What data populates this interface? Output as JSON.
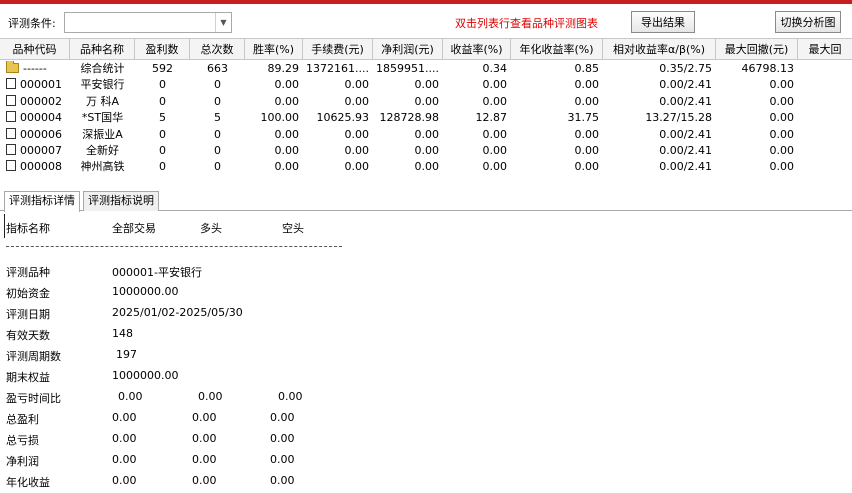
{
  "toolbar": {
    "filter_label": "评测条件:",
    "filter_value": "",
    "hint": "双击列表行查看品种评测图表",
    "export_label": "导出结果",
    "switch_label": "切换分析图"
  },
  "grid": {
    "columns": [
      "品种代码",
      "品种名称",
      "盈利数",
      "总次数",
      "胜率(%)",
      "手续费(元)",
      "净利润(元)",
      "收益率(%)",
      "年化收益率(%)",
      "相对收益率α/β(%)",
      "最大回撤(元)",
      "最大回"
    ],
    "rows": [
      {
        "icon": "folder-icon",
        "cells": [
          "------",
          "综合统计",
          "592",
          "663",
          "89.29",
          "1372161....",
          "1859951....",
          "0.34",
          "0.85",
          "0.35/2.75",
          "46798.13",
          ""
        ]
      },
      {
        "icon": "document-icon",
        "cells": [
          "000001",
          "平安银行",
          "0",
          "0",
          "0.00",
          "0.00",
          "0.00",
          "0.00",
          "0.00",
          "0.00/2.41",
          "0.00",
          ""
        ]
      },
      {
        "icon": "document-icon",
        "cells": [
          "000002",
          "万 科A",
          "0",
          "0",
          "0.00",
          "0.00",
          "0.00",
          "0.00",
          "0.00",
          "0.00/2.41",
          "0.00",
          ""
        ]
      },
      {
        "icon": "document-icon",
        "cells": [
          "000004",
          "*ST国华",
          "5",
          "5",
          "100.00",
          "10625.93",
          "128728.98",
          "12.87",
          "31.75",
          "13.27/15.28",
          "0.00",
          ""
        ]
      },
      {
        "icon": "document-icon",
        "cells": [
          "000006",
          "深振业A",
          "0",
          "0",
          "0.00",
          "0.00",
          "0.00",
          "0.00",
          "0.00",
          "0.00/2.41",
          "0.00",
          ""
        ]
      },
      {
        "icon": "document-icon",
        "cells": [
          "000007",
          "全新好",
          "0",
          "0",
          "0.00",
          "0.00",
          "0.00",
          "0.00",
          "0.00",
          "0.00/2.41",
          "0.00",
          ""
        ]
      },
      {
        "icon": "document-icon",
        "cells": [
          "000008",
          "神州高铁",
          "0",
          "0",
          "0.00",
          "0.00",
          "0.00",
          "0.00",
          "0.00",
          "0.00/2.41",
          "0.00",
          ""
        ]
      }
    ]
  },
  "tabs": [
    {
      "label": "评测指标详情",
      "active": true
    },
    {
      "label": "评测指标说明",
      "active": false
    }
  ],
  "detail": {
    "header": {
      "name": "指标名称",
      "all": "全部交易",
      "long": "多头",
      "short": "空头"
    },
    "info": [
      {
        "label": "评测品种",
        "value": "000001-平安银行"
      },
      {
        "label": "初始资金",
        "value": "1000000.00"
      },
      {
        "label": "评测日期",
        "value": "2025/01/02-2025/05/30"
      },
      {
        "label": "有效天数",
        "value": "148"
      },
      {
        "label": "评测周期数",
        "value": "197"
      },
      {
        "label": "期末权益",
        "value": "1000000.00"
      }
    ],
    "metrics": [
      {
        "label": "盈亏时间比",
        "all": "0.00",
        "long": "0.00",
        "short": "0.00"
      },
      {
        "label": "总盈利",
        "all": "0.00",
        "long": "0.00",
        "short": "0.00"
      },
      {
        "label": "总亏损",
        "all": "0.00",
        "long": "0.00",
        "short": "0.00"
      },
      {
        "label": "净利润",
        "all": "0.00",
        "long": "0.00",
        "short": "0.00"
      },
      {
        "label": "年化收益",
        "all": "0.00",
        "long": "0.00",
        "short": "0.00"
      }
    ]
  }
}
